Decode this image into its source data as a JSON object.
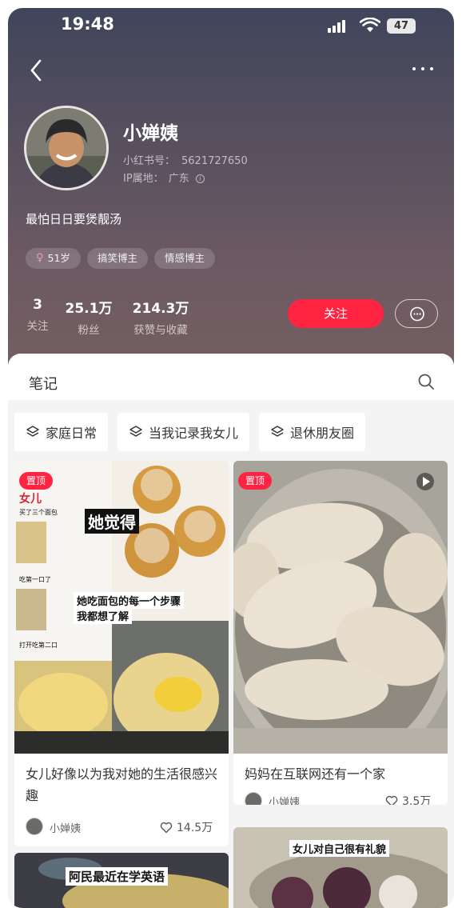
{
  "status_bar": {
    "time": "19:48",
    "battery": "47"
  },
  "profile": {
    "nickname": "小婵姨",
    "red_id_label": "小红书号：",
    "red_id": "5621727650",
    "ip_label": "IP属地：",
    "ip_location": "广东",
    "bio": "最怕日日要煲靓汤",
    "tags": [
      "51岁",
      "搞笑博主",
      "情感博主"
    ],
    "stats": [
      {
        "value": "3",
        "label": "关注"
      },
      {
        "value": "25.1万",
        "label": "粉丝"
      },
      {
        "value": "214.3万",
        "label": "获赞与收藏"
      }
    ],
    "follow_label": "关注"
  },
  "notes": {
    "title": "笔记",
    "collections": [
      "家庭日常",
      "当我记录我女儿",
      "退休朋友圈"
    ],
    "cards": [
      {
        "pinned": "置顶",
        "title": "女儿好像以为我对她的生活很感兴趣",
        "author": "小婵姨",
        "likes": "14.5万",
        "image_text": [
          "女儿",
          "买了三个面包",
          "吃第一口了",
          "打开吃第二口",
          "她觉得",
          "她吃面包的每一个步骤",
          "我都想了解"
        ]
      },
      {
        "pinned": "置顶",
        "title": "妈妈在互联网还有一个家",
        "author": "小婵姨",
        "likes": "3.5万"
      },
      {
        "image_text": "阿民最近在学英语"
      },
      {
        "image_text": "女儿对自己很有礼貌"
      }
    ]
  },
  "colors": {
    "accent": "#ff2442",
    "hero_top": "#40455b",
    "hero_bottom": "#74605f"
  },
  "icons": [
    "back-icon",
    "more-icon",
    "info-icon",
    "female-icon",
    "message-icon",
    "search-icon",
    "layers-icon",
    "heart-icon",
    "play-icon"
  ]
}
